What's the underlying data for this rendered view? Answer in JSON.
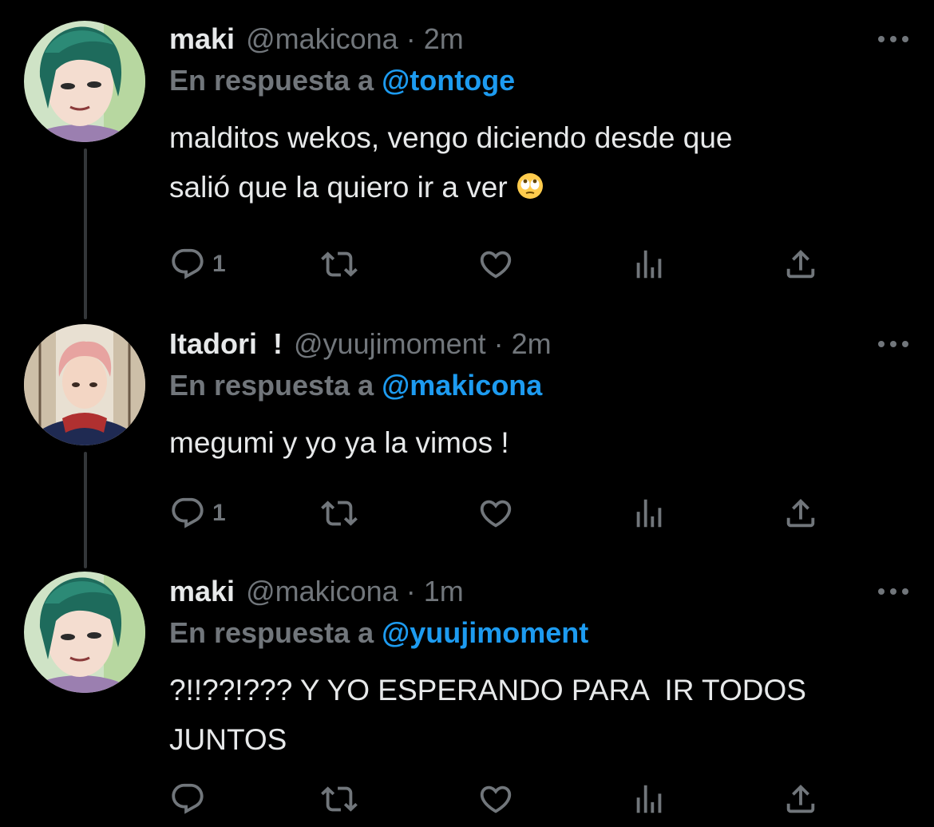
{
  "colors": {
    "background": "#000000",
    "name": "#e7e9ea",
    "secondary": "#71767b",
    "mention": "#1d9bf0",
    "thread_line": "#333639"
  },
  "tweets": [
    {
      "name": "maki",
      "handle": "@makicona",
      "separator": "·",
      "time": "2m",
      "reply_prefix": "En respuesta a",
      "reply_to": "@tontoge",
      "text": "malditos wekos, vengo diciendo desde que\nsalió que la quiero ir a ver",
      "text_emoji": "face-with-rolling-eyes-emoji",
      "avatar": "maki-avatar",
      "reply_count": "1"
    },
    {
      "name": "Itadori  !",
      "handle": "@yuujimoment",
      "separator": "·",
      "time": "2m",
      "reply_prefix": "En respuesta a",
      "reply_to": "@makicona",
      "text": "megumi y yo ya la vimos !",
      "avatar": "itadori-avatar",
      "reply_count": "1"
    },
    {
      "name": "maki",
      "handle": "@makicona",
      "separator": "·",
      "time": "1m",
      "reply_prefix": "En respuesta a",
      "reply_to": "@yuujimoment",
      "text": "?!!??!??? Y YO ESPERANDO PARA  IR TODOS\nJUNTOS",
      "avatar": "maki-avatar",
      "reply_count": ""
    }
  ],
  "action_icons": [
    "reply-icon",
    "retweet-icon",
    "like-icon",
    "analytics-icon",
    "share-icon"
  ]
}
